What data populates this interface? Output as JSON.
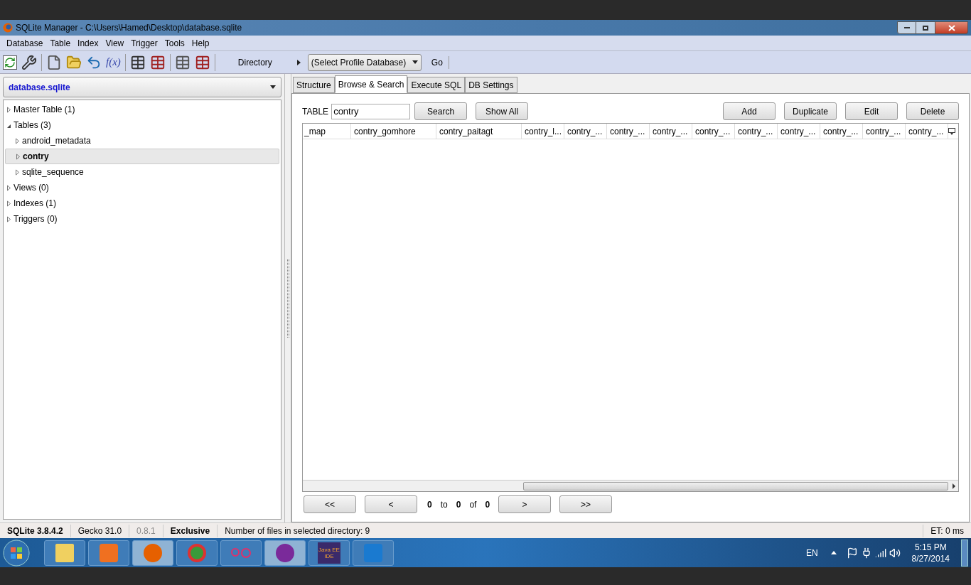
{
  "window": {
    "title": "SQLite Manager - C:\\Users\\Hamed\\Desktop\\database.sqlite"
  },
  "menu": [
    "Database",
    "Table",
    "Index",
    "View",
    "Trigger",
    "Tools",
    "Help"
  ],
  "toolbar": {
    "function_label": "f(x)",
    "directory": "Directory",
    "profile_select": "(Select Profile Database)",
    "go": "Go"
  },
  "database_select": "database.sqlite",
  "tree": [
    {
      "label": "Master Table (1)",
      "expanded": false,
      "selected": false
    },
    {
      "label": "Tables (3)",
      "expanded": true,
      "selected": false,
      "children": [
        {
          "label": "android_metadata",
          "expanded": false,
          "selected": false
        },
        {
          "label": "contry",
          "expanded": false,
          "selected": true
        },
        {
          "label": "sqlite_sequence",
          "expanded": false,
          "selected": false
        }
      ]
    },
    {
      "label": "Views (0)",
      "expanded": false,
      "selected": false
    },
    {
      "label": "Indexes (1)",
      "expanded": false,
      "selected": false
    },
    {
      "label": "Triggers (0)",
      "expanded": false,
      "selected": false
    }
  ],
  "tabs": [
    {
      "label": "Structure",
      "selected": false
    },
    {
      "label": "Browse & Search",
      "selected": true
    },
    {
      "label": "Execute SQL",
      "selected": false
    },
    {
      "label": "DB Settings",
      "selected": false
    }
  ],
  "browse": {
    "table_label": "TABLE",
    "table_value": "contry",
    "buttons_left": [
      "Search",
      "Show All"
    ],
    "buttons_right": [
      "Add",
      "Duplicate",
      "Edit",
      "Delete"
    ],
    "columns": [
      "_map",
      "contry_gomhore",
      "contry_paitagt",
      "contry_l...",
      "contry_...",
      "contry_...",
      "contry_...",
      "contry_...",
      "contry_...",
      "contry_...",
      "contry_...",
      "contry_...",
      "contry_..."
    ],
    "pager": {
      "first": "<<",
      "prev": "<",
      "from": "0",
      "to_label": "to",
      "to": "0",
      "of_label": "of",
      "total": "0",
      "next": ">",
      "last": ">>"
    }
  },
  "status_bar": {
    "sqlite": "SQLite 3.8.4.2",
    "gecko": "Gecko 31.0",
    "version": "0.8.1",
    "mode": "Exclusive",
    "message": "Number of files in selected directory: 9",
    "timing": "ET: 0 ms"
  },
  "taskbar": {
    "java_icon_text": "Java EE IDE",
    "language": "EN",
    "time": "5:15 PM",
    "date": "8/27/2014"
  }
}
